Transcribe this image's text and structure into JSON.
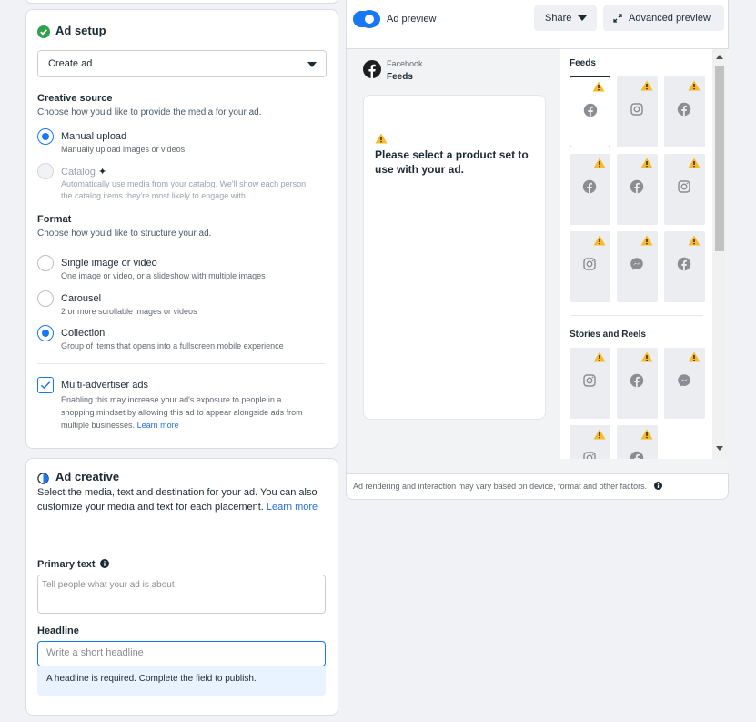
{
  "ad_setup": {
    "title": "Ad setup",
    "create_select": {
      "value": "Create ad"
    },
    "creative_source": {
      "label": "Creative source",
      "description": "Choose how you'd like to provide the media for your ad.",
      "options": [
        {
          "title": "Manual upload",
          "desc": "Manually upload images or videos.",
          "selected": true,
          "disabled": false
        },
        {
          "title": "Catalog",
          "desc_line1": "Automatically use media from your catalog. We'll show each person",
          "desc_line2": "the catalog items they're most likely to engage with.",
          "selected": false,
          "disabled": true
        }
      ]
    },
    "format": {
      "label": "Format",
      "description": "Choose how you'd like to structure your ad.",
      "options": [
        {
          "title": "Single image or video",
          "desc": "One image or video, or a slideshow with multiple images",
          "selected": false
        },
        {
          "title": "Carousel",
          "desc": "2 or more scrollable images or videos",
          "selected": false
        },
        {
          "title": "Collection",
          "desc": "Group of items that opens into a fullscreen mobile experience",
          "selected": true
        }
      ]
    },
    "multi_advertiser": {
      "title": "Multi-advertiser ads",
      "checked": true,
      "desc_line1": "Enabling this may increase your ad's exposure to people in a",
      "desc_line2": "shopping mindset by allowing this ad to appear alongside ads from",
      "desc_line3": "multiple businesses.",
      "learn_more": "Learn more"
    }
  },
  "ad_creative": {
    "title": "Ad creative",
    "desc_line1": "Select the media, text and destination for your ad. You can also",
    "desc_line2": "customize your media and text for each placement.",
    "learn_more": "Learn more",
    "primary_text": {
      "label": "Primary text",
      "placeholder": "Tell people what your ad is about"
    },
    "headline": {
      "label": "Headline",
      "placeholder": "Write a short headline",
      "error": "A headline is required. Complete the field to publish."
    }
  },
  "preview": {
    "toggle_label": "Ad preview",
    "toggle_on": true,
    "share_label": "Share",
    "advanced_label": "Advanced preview",
    "platform": "Facebook",
    "placement": "Feeds",
    "message_line1": "Please select a product set to",
    "message_line2": "use with your ad.",
    "sections": [
      {
        "title": "Feeds",
        "items": [
          "facebook",
          "instagram",
          "facebook",
          "facebook",
          "facebook",
          "instagram",
          "instagram",
          "messenger",
          "facebook"
        ]
      },
      {
        "title": "Stories and Reels",
        "items": [
          "instagram",
          "facebook",
          "messenger",
          "instagram",
          "facebook"
        ]
      }
    ],
    "footer_note": "Ad rendering and interaction may vary based on device, format and other factors.",
    "colors": {
      "accent": "#1877f2",
      "warning": "#f7b928",
      "platform_icon": "#8a8d91"
    }
  }
}
